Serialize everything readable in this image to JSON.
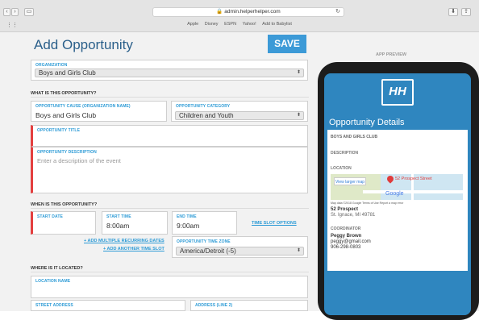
{
  "browser": {
    "url": "admin.helperhelper.com",
    "favorites": [
      "Apple",
      "Disney",
      "ESPN",
      "Yahoo!",
      "Add to Babylist"
    ]
  },
  "page": {
    "title": "Add Opportunity",
    "save_label": "SAVE"
  },
  "organization": {
    "label": "ORGANIZATION",
    "value": "Boys and Girls Club"
  },
  "what": {
    "heading": "WHAT IS THIS OPPORTUNITY?",
    "cause_label": "OPPORTUNITY CAUSE (ORGANIZATION NAME)",
    "cause_value": "Boys and Girls Club",
    "category_label": "OPPORTUNITY CATEGORY",
    "category_value": "Children and Youth",
    "title_label": "OPPORTUNITY TITLE",
    "desc_label": "OPPORTUNITY DESCRIPTION",
    "desc_placeholder": "Enter a description of the event"
  },
  "when": {
    "heading": "WHEN IS THIS OPPORTUNITY?",
    "start_date_label": "START DATE",
    "start_time_label": "START TIME",
    "start_time_value": "8:00am",
    "end_time_label": "END TIME",
    "end_time_value": "9:00am",
    "slot_options": "TIME SLOT OPTIONS",
    "add_recurring": "+ ADD MULTIPLE RECURRING DATES",
    "add_time_slot": "+ ADD ANOTHER TIME SLOT",
    "tz_label": "OPPORTUNITY TIME ZONE",
    "tz_value": "America/Detroit (-5)"
  },
  "where": {
    "heading": "WHERE IS IT LOCATED?",
    "location_label": "LOCATION NAME",
    "street_label": "STREET ADDRESS",
    "address2_label": "ADDRESS (LINE 2)"
  },
  "preview": {
    "label": "APP PREVIEW",
    "logo": "HH",
    "heading": "Opportunity Details",
    "org": "BOYS AND GIRLS CLUB",
    "desc_label": "DESCRIPTION",
    "location_label": "LOCATION",
    "view_larger_map": "View larger map",
    "map_pin_label": "52 Prospect Street",
    "map_footer": "Map data ©2018 Google   Terms of Use   Report a map error",
    "address_name": "52 Prospect",
    "address_city": "St. Ignace, MI 49781",
    "coordinator_label": "COORDINATOR",
    "coordinator_name": "Peggy Brown",
    "coordinator_email": "peggy@gmail.com",
    "coordinator_phone": "906-298-0803"
  }
}
